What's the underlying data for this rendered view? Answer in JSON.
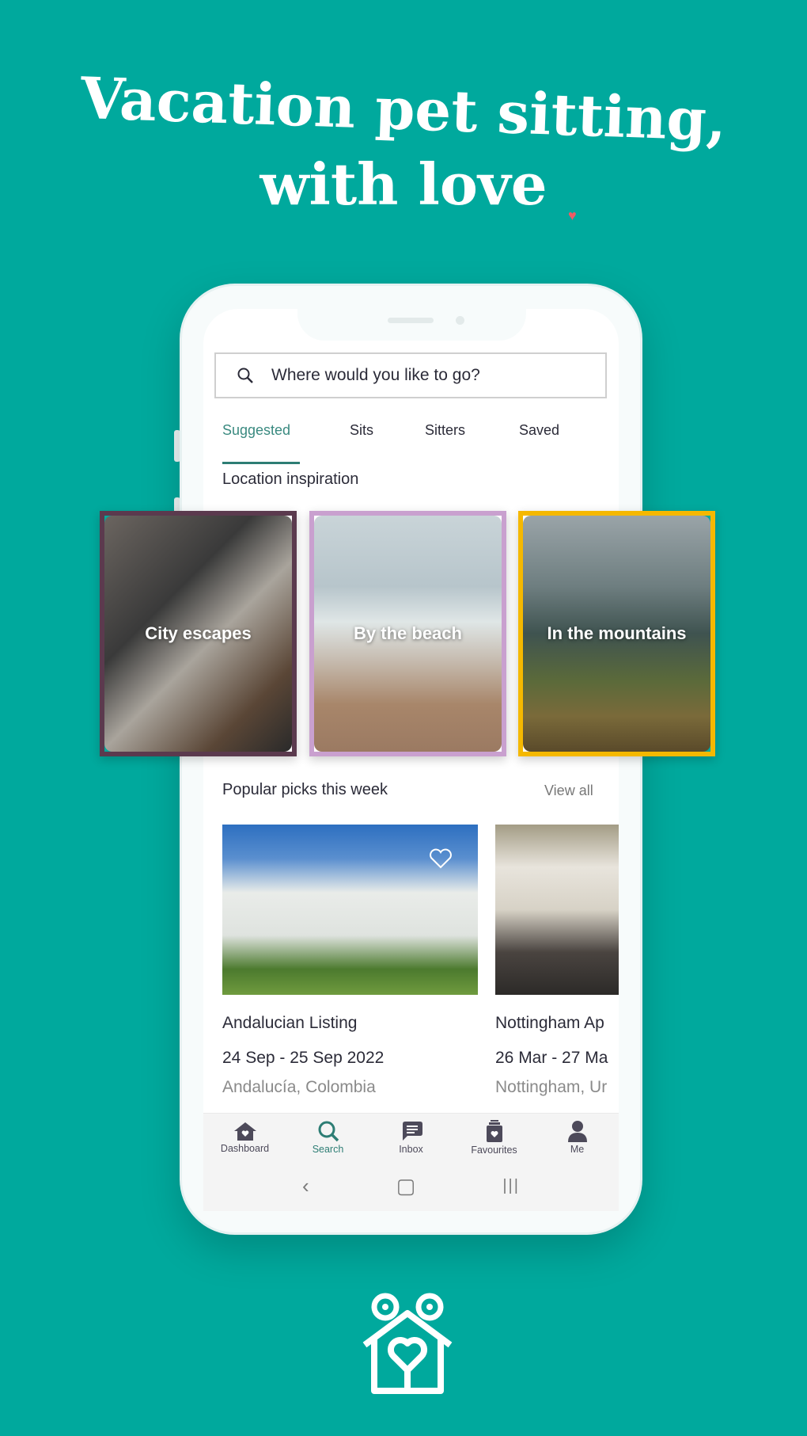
{
  "headline": {
    "line1": "Vacation pet sitting,",
    "line2": "with love",
    "heart_color": "#f05a64"
  },
  "search": {
    "placeholder": "Where would you like to go?",
    "icon": "search-icon"
  },
  "tabs": [
    {
      "label": "Suggested",
      "active": true
    },
    {
      "label": "Sits"
    },
    {
      "label": "Sitters"
    },
    {
      "label": "Saved"
    }
  ],
  "location_section": {
    "title": "Location inspiration",
    "cards": [
      {
        "label": "City escapes",
        "border_color": "#5b3a4e"
      },
      {
        "label": "By the beach",
        "border_color": "#c9a0cf"
      },
      {
        "label": "In the mountains",
        "border_color": "#f5b800"
      }
    ]
  },
  "popular": {
    "title": "Popular picks this week",
    "view_all": "View all",
    "listings": [
      {
        "title": "Andalucian Listing",
        "dates": "24 Sep - 25 Sep 2022",
        "location": "Andalucía, Colombia"
      },
      {
        "title": "Nottingham Ap",
        "dates": "26 Mar - 27 Ma",
        "location": "Nottingham, Ur"
      }
    ]
  },
  "bottom_nav": [
    {
      "label": "Dashboard",
      "icon": "house-heart-icon"
    },
    {
      "label": "Search",
      "icon": "search-icon",
      "active": true
    },
    {
      "label": "Inbox",
      "icon": "chat-icon"
    },
    {
      "label": "Favourites",
      "icon": "favourites-jar-icon"
    },
    {
      "label": "Me",
      "icon": "person-icon"
    }
  ],
  "system_nav": {
    "back": "‹",
    "home": "▢",
    "recents": "|||"
  },
  "colors": {
    "background": "#00a99d",
    "accent": "#2d7d74"
  }
}
